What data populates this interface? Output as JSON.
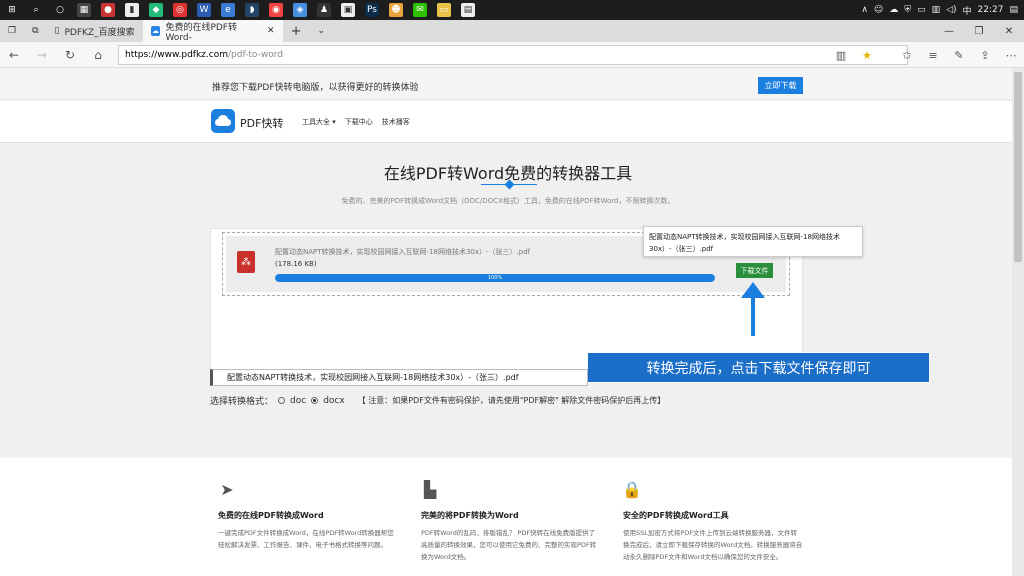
{
  "taskbar": {
    "time": "22:27",
    "ime": "中"
  },
  "browser": {
    "tabs": [
      {
        "label": "PDFKZ_百度搜索"
      },
      {
        "label": "免费的在线PDF转Word-"
      }
    ],
    "url_host": "https://www.pdfkz.com",
    "url_path": "/pdf-to-word"
  },
  "promo": {
    "text": "推荐您下载PDF快转电脑版，以获得更好的转换体验",
    "button": "立即下载"
  },
  "header": {
    "logo_text": "PDF快转",
    "nav": [
      "工具大全 ▾",
      "下载中心",
      "技术播客"
    ]
  },
  "hero": {
    "title": "在线PDF转Word免费的转换器工具",
    "subtitle": "免费的、完美的PDF转换成Word文档（DOC/DOCX格式）工具，免费的在线PDF转Word，不限转换次数。"
  },
  "upload": {
    "file_name": "配置动态NAPT转换技术，实现校园网接入互联网-18网络技术30x）-（张三）.pdf",
    "file_size": "(178.16 KB)",
    "progress": 1.0,
    "progress_label": "100%",
    "download_button": "下载文件",
    "tooltip": "配置动态NAPT转换技术，实现校园网接入互联网-18网络技术30x）-（张三）.pdf"
  },
  "callout": "转换完成后，点击下载文件保存即可",
  "file_field": "配置动态NAPT转换技术，实现校园网接入互联网-18网络技术30x）-（张三）.pdf",
  "format": {
    "label": "选择转换格式：",
    "options": [
      "doc",
      "docx"
    ],
    "selected": "docx",
    "notice": "【 注意：如果PDF文件有密码保护，请先使用\"PDF解密\" 解除文件密码保护后再上传】"
  },
  "features": [
    {
      "title": "免费的在线PDF转换成Word",
      "desc": "一键完成PDF文件转换成Word，在线PDF转Word转换器帮您轻松解决发票、工作报告、课件、电子书格式转换等问题。"
    },
    {
      "title": "完美的将PDF转换为Word",
      "desc": "PDF转Word的乱码，排版错乱？ PDF快转在线免费版提供了高质量的转换效果，您可以使用它免费的、完整的实现PDF转换为Word文档。"
    },
    {
      "title": "安全的PDF转换成Word工具",
      "desc": "使用SSL加密方式将PDF文件上传到云端转换服务器，文件转换完成后，请立即下载保存转换的Word文档。转换服务器将自动永久删除PDF文件和Word文档以确保您的文件安全。"
    }
  ],
  "colors": {
    "accent": "#1b7fe0",
    "download_green": "#2a8f3a"
  }
}
